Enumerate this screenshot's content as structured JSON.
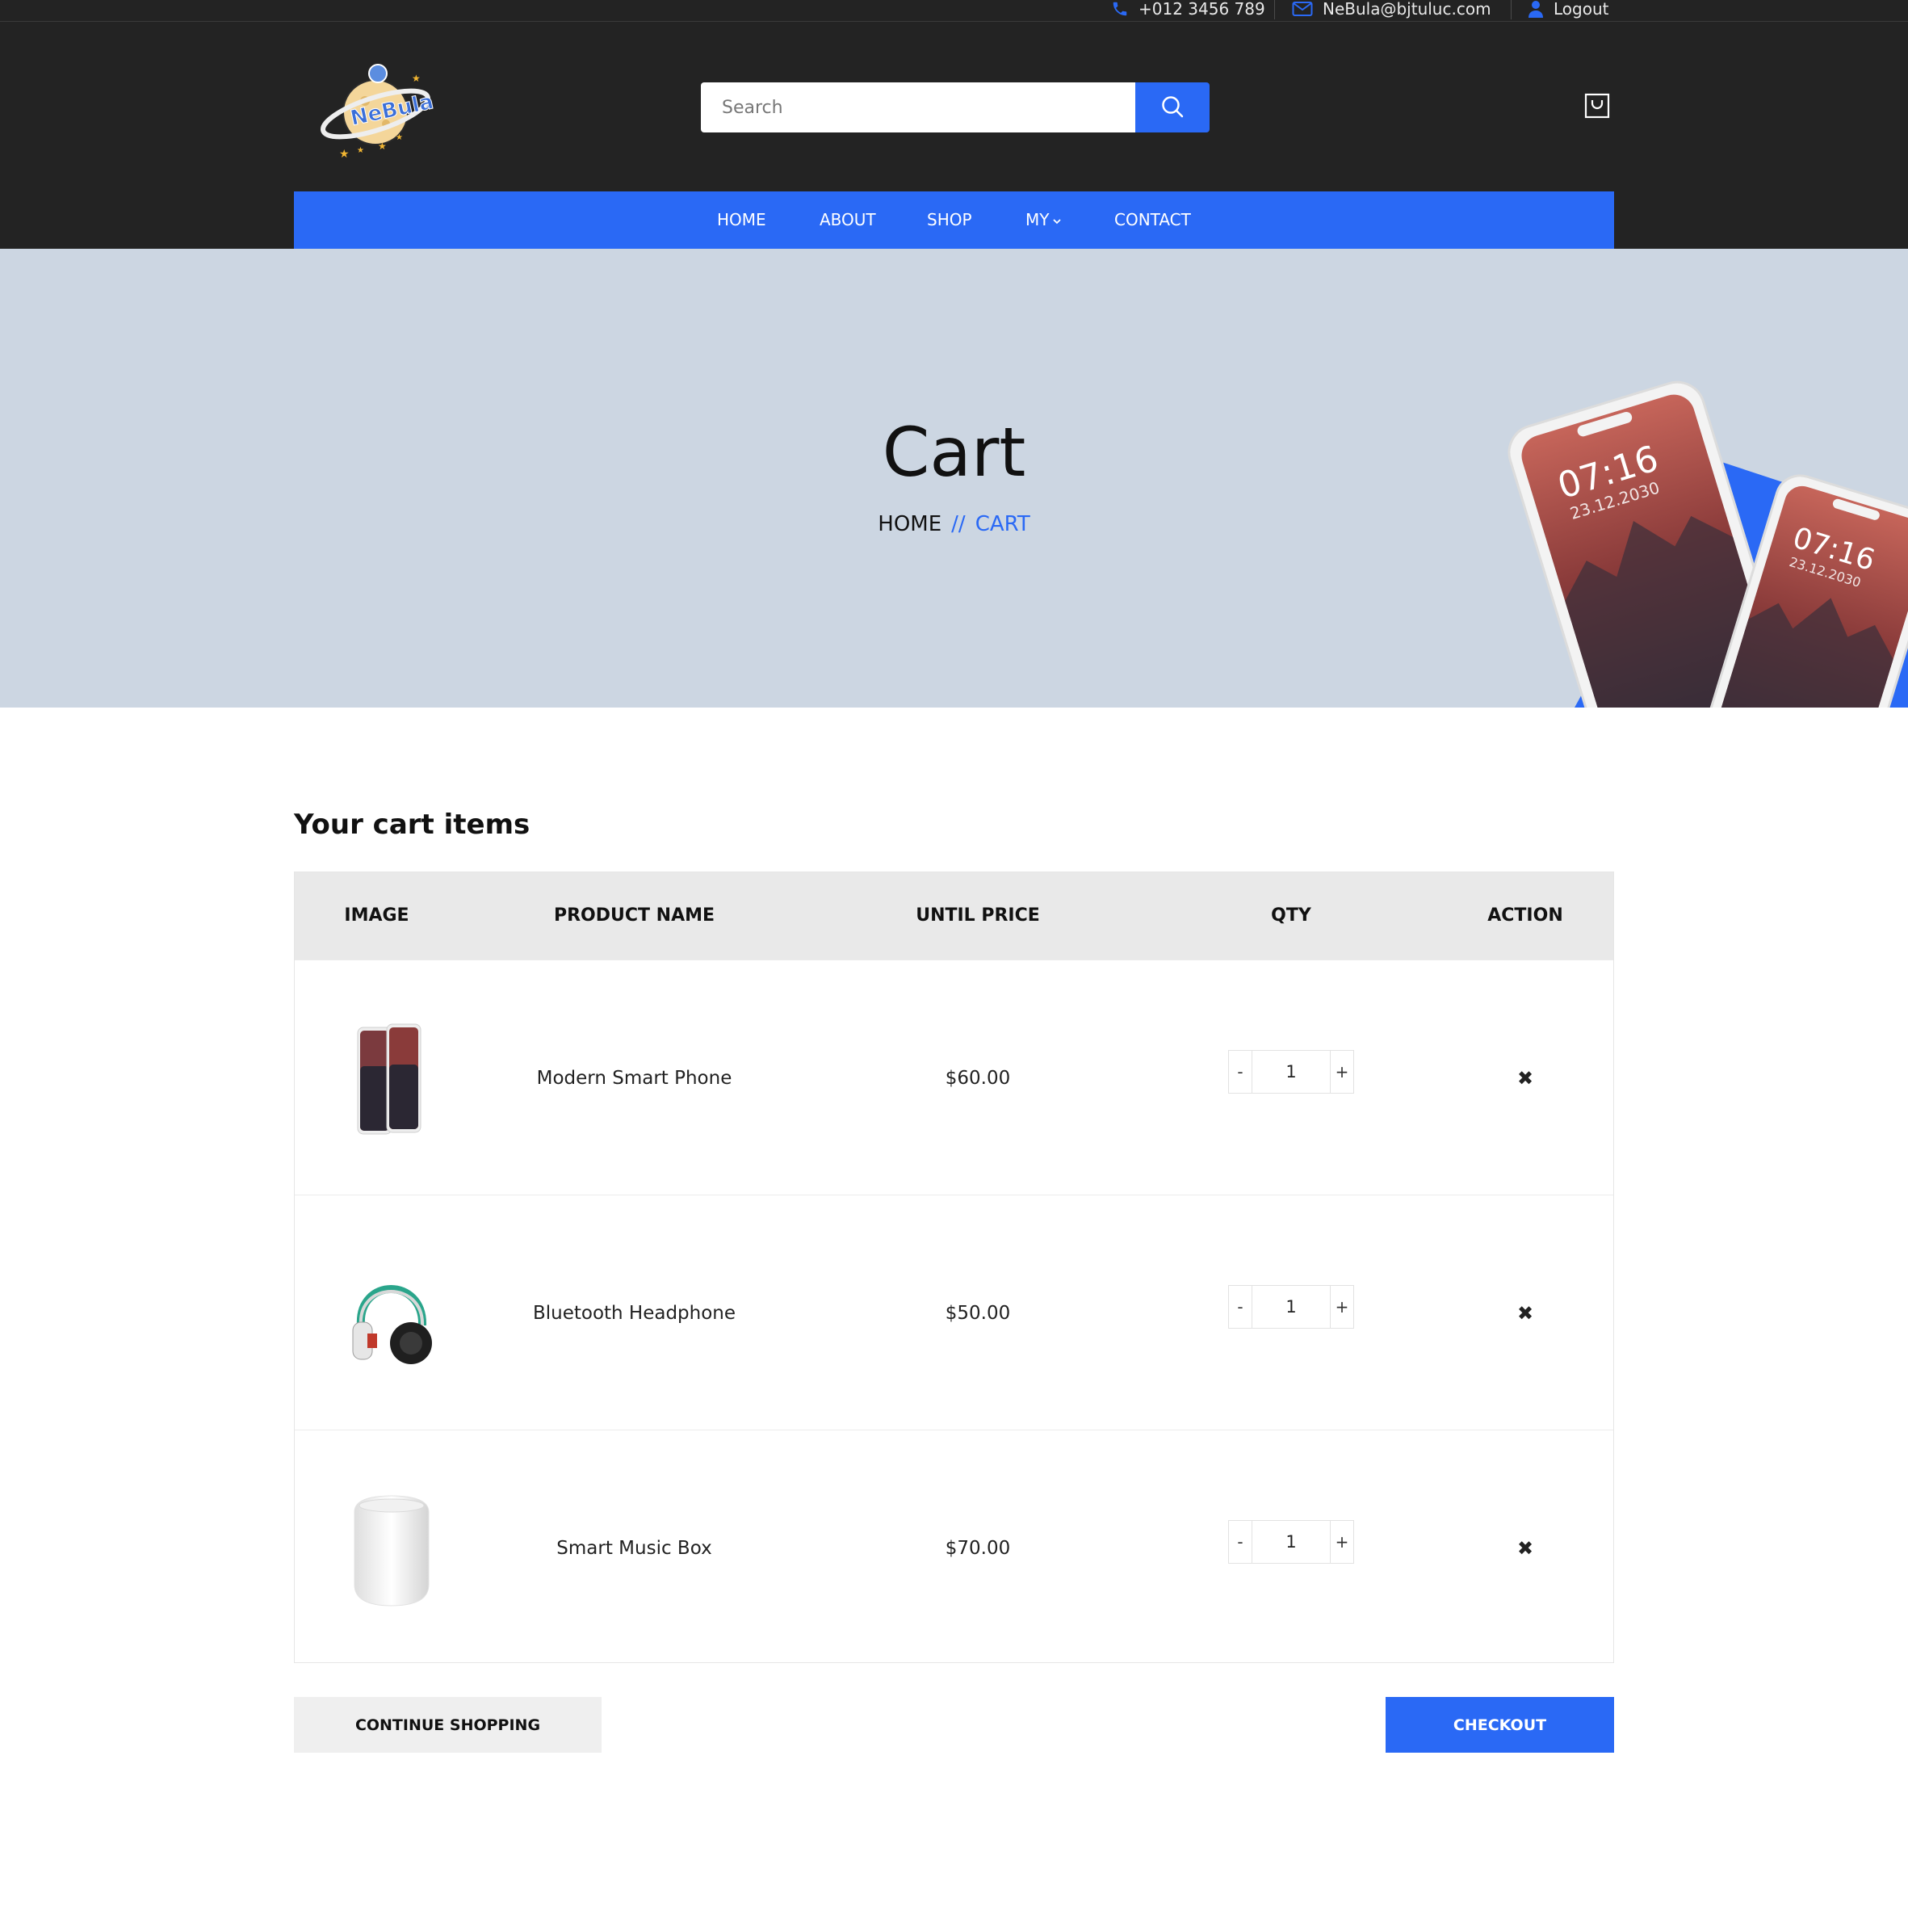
{
  "topbar": {
    "phone": "+012 3456 789",
    "email": "NeBula@bjtuluc.com",
    "logout": "Logout",
    "icons": [
      "phone-icon",
      "mail-icon",
      "user-icon"
    ]
  },
  "header": {
    "logo_alt": "Nebula",
    "search_placeholder": "Search",
    "search_icon": "search-icon",
    "cart_icon": "shopping-bag-icon"
  },
  "nav": {
    "items": [
      "HOME",
      "ABOUT",
      "SHOP",
      "MY",
      "CONTACT"
    ],
    "dropdown_icon": "chevron-down-icon"
  },
  "banner": {
    "title": "Cart",
    "breadcrumb_home": "HOME",
    "breadcrumb_sep": "//",
    "breadcrumb_current": "CART",
    "phone_time": "07:16",
    "phone_date": "23.12.2030"
  },
  "cart": {
    "heading": "Your cart items",
    "columns": [
      "IMAGE",
      "PRODUCT NAME",
      "UNTIL PRICE",
      "QTY",
      "ACTION"
    ],
    "items": [
      {
        "name": "Modern Smart Phone",
        "price": "$60.00",
        "qty": "1",
        "image": "smartphone-image"
      },
      {
        "name": "Bluetooth Headphone",
        "price": "$50.00",
        "qty": "1",
        "image": "headphone-image"
      },
      {
        "name": "Smart Music Box",
        "price": "$70.00",
        "qty": "1",
        "image": "speaker-image"
      }
    ],
    "minus": "-",
    "plus": "+",
    "remove": "✖"
  },
  "actions": {
    "continue": "CONTINUE SHOPPING",
    "checkout": "CHECKOUT"
  },
  "colors": {
    "accent": "#2a69f5",
    "dark": "#232323",
    "banner_bg": "#ccd6e2"
  }
}
